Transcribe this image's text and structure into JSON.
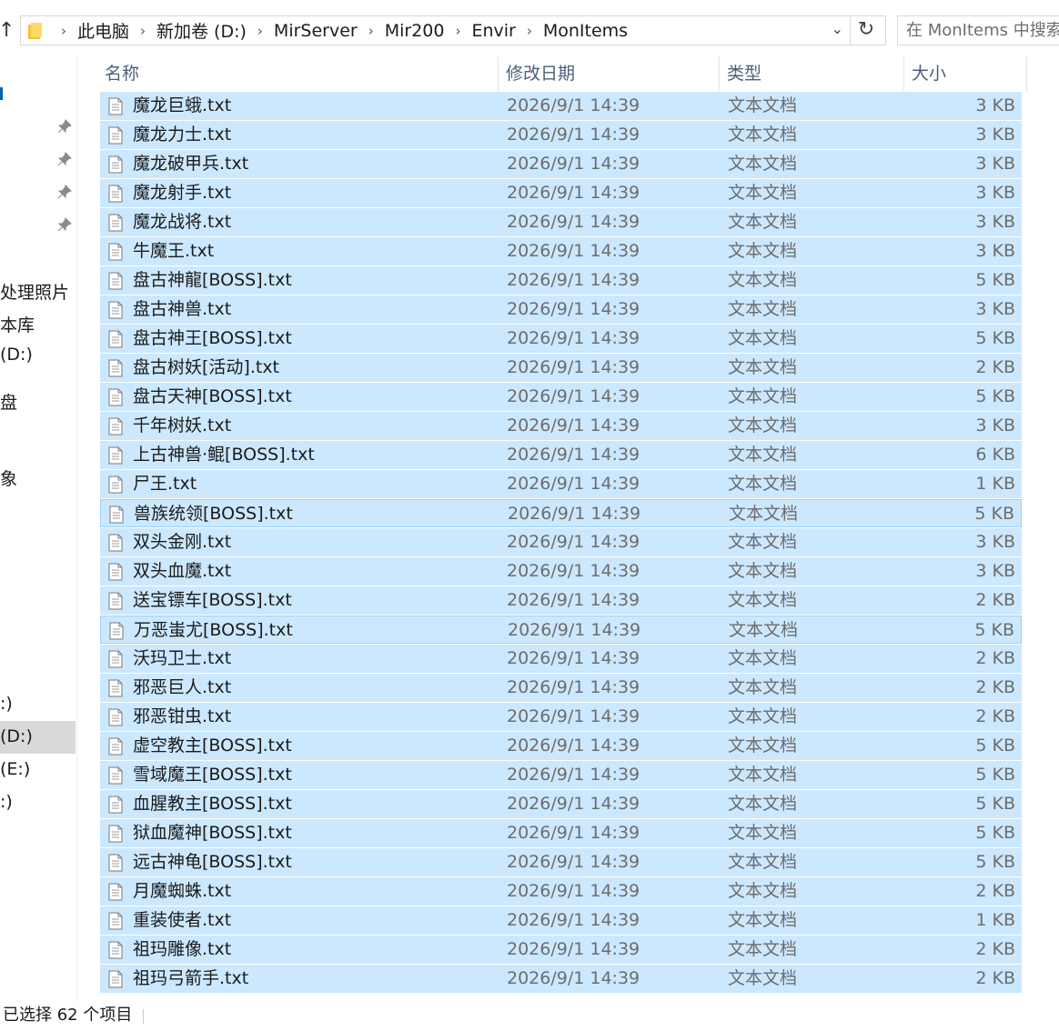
{
  "address": {
    "breadcrumb": [
      "此电脑",
      "新加卷 (D:)",
      "MirServer",
      "Mir200",
      "Envir",
      "MonItems"
    ],
    "search_placeholder": "在 MonItems 中搜索"
  },
  "nav": {
    "items": [
      "处理照片",
      "本库",
      "(D:)",
      "盘",
      "象",
      ":)",
      "(D:)",
      "(E:)",
      ":)"
    ]
  },
  "columns": {
    "name": "名称",
    "date": "修改日期",
    "type": "类型",
    "size": "大小"
  },
  "files": [
    {
      "name": "魔龙巨蛾.txt",
      "date": "2026/9/1 14:39",
      "type": "文本文档",
      "size": "3 KB"
    },
    {
      "name": "魔龙力士.txt",
      "date": "2026/9/1 14:39",
      "type": "文本文档",
      "size": "3 KB"
    },
    {
      "name": "魔龙破甲兵.txt",
      "date": "2026/9/1 14:39",
      "type": "文本文档",
      "size": "3 KB"
    },
    {
      "name": "魔龙射手.txt",
      "date": "2026/9/1 14:39",
      "type": "文本文档",
      "size": "3 KB"
    },
    {
      "name": "魔龙战将.txt",
      "date": "2026/9/1 14:39",
      "type": "文本文档",
      "size": "3 KB"
    },
    {
      "name": "牛魔王.txt",
      "date": "2026/9/1 14:39",
      "type": "文本文档",
      "size": "3 KB"
    },
    {
      "name": "盘古神龍[BOSS].txt",
      "date": "2026/9/1 14:39",
      "type": "文本文档",
      "size": "5 KB"
    },
    {
      "name": "盘古神兽.txt",
      "date": "2026/9/1 14:39",
      "type": "文本文档",
      "size": "3 KB"
    },
    {
      "name": "盘古神王[BOSS].txt",
      "date": "2026/9/1 14:39",
      "type": "文本文档",
      "size": "5 KB"
    },
    {
      "name": "盘古树妖[活动].txt",
      "date": "2026/9/1 14:39",
      "type": "文本文档",
      "size": "2 KB"
    },
    {
      "name": "盘古天神[BOSS].txt",
      "date": "2026/9/1 14:39",
      "type": "文本文档",
      "size": "5 KB"
    },
    {
      "name": "千年树妖.txt",
      "date": "2026/9/1 14:39",
      "type": "文本文档",
      "size": "3 KB"
    },
    {
      "name": "上古神兽·鲲[BOSS].txt",
      "date": "2026/9/1 14:39",
      "type": "文本文档",
      "size": "6 KB"
    },
    {
      "name": "尸王.txt",
      "date": "2026/9/1 14:39",
      "type": "文本文档",
      "size": "1 KB"
    },
    {
      "name": "兽族统领[BOSS].txt",
      "date": "2026/9/1 14:39",
      "type": "文本文档",
      "size": "5 KB"
    },
    {
      "name": "双头金刚.txt",
      "date": "2026/9/1 14:39",
      "type": "文本文档",
      "size": "3 KB"
    },
    {
      "name": "双头血魔.txt",
      "date": "2026/9/1 14:39",
      "type": "文本文档",
      "size": "3 KB"
    },
    {
      "name": "送宝镖车[BOSS].txt",
      "date": "2026/9/1 14:39",
      "type": "文本文档",
      "size": "2 KB"
    },
    {
      "name": "万恶蚩尤[BOSS].txt",
      "date": "2026/9/1 14:39",
      "type": "文本文档",
      "size": "5 KB"
    },
    {
      "name": "沃玛卫士.txt",
      "date": "2026/9/1 14:39",
      "type": "文本文档",
      "size": "2 KB"
    },
    {
      "name": "邪恶巨人.txt",
      "date": "2026/9/1 14:39",
      "type": "文本文档",
      "size": "2 KB"
    },
    {
      "name": "邪恶钳虫.txt",
      "date": "2026/9/1 14:39",
      "type": "文本文档",
      "size": "2 KB"
    },
    {
      "name": "虚空教主[BOSS].txt",
      "date": "2026/9/1 14:39",
      "type": "文本文档",
      "size": "5 KB"
    },
    {
      "name": "雪域魔王[BOSS].txt",
      "date": "2026/9/1 14:39",
      "type": "文本文档",
      "size": "5 KB"
    },
    {
      "name": "血腥教主[BOSS].txt",
      "date": "2026/9/1 14:39",
      "type": "文本文档",
      "size": "5 KB"
    },
    {
      "name": "狱血魔神[BOSS].txt",
      "date": "2026/9/1 14:39",
      "type": "文本文档",
      "size": "5 KB"
    },
    {
      "name": "远古神龟[BOSS].txt",
      "date": "2026/9/1 14:39",
      "type": "文本文档",
      "size": "5 KB"
    },
    {
      "name": "月魔蜘蛛.txt",
      "date": "2026/9/1 14:39",
      "type": "文本文档",
      "size": "2 KB"
    },
    {
      "name": "重装使者.txt",
      "date": "2026/9/1 14:39",
      "type": "文本文档",
      "size": "1 KB"
    },
    {
      "name": "祖玛雕像.txt",
      "date": "2026/9/1 14:39",
      "type": "文本文档",
      "size": "2 KB"
    },
    {
      "name": "祖玛弓箭手.txt",
      "date": "2026/9/1 14:39",
      "type": "文本文档",
      "size": "2 KB"
    }
  ],
  "status": {
    "text": "已选择 62 个项目"
  },
  "colors": {
    "selection": "#cce8ff",
    "focus_border": "#99d1ff"
  }
}
